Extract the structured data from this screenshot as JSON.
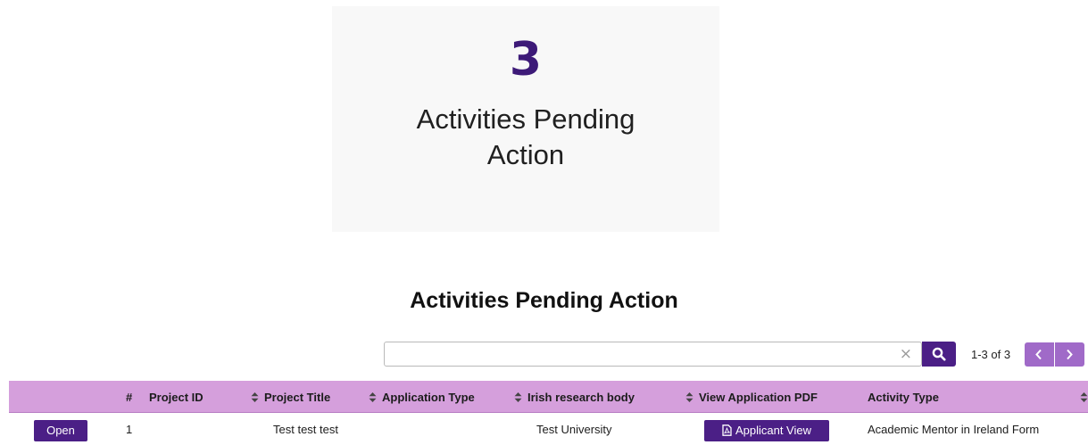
{
  "summary_card": {
    "count": "3",
    "label": "Activities Pending Action"
  },
  "section": {
    "title": "Activities Pending Action"
  },
  "search": {
    "value": "",
    "placeholder": "",
    "clear_symbol": "×"
  },
  "pagination": {
    "range_text": "1-3 of 3"
  },
  "table": {
    "columns": [
      {
        "label": "#",
        "sortable": false
      },
      {
        "label": "Project ID",
        "sortable": false
      },
      {
        "label": "Project Title",
        "sortable": true
      },
      {
        "label": "Application Type",
        "sortable": true
      },
      {
        "label": "Irish research body",
        "sortable": true
      },
      {
        "label": "View Application PDF",
        "sortable": true
      },
      {
        "label": "Activity Type",
        "sortable": false
      }
    ],
    "rows": [
      {
        "action_label": "Open",
        "number": "1",
        "project_id": "",
        "project_title": "Test test test",
        "application_type": "",
        "research_body": "Test University",
        "pdf_button_label": "Applicant View",
        "activity_type": "Academic Mentor in Ireland Form"
      }
    ]
  },
  "colors": {
    "primary": "#4b1f86",
    "header_bg": "#d59fdc",
    "pager_bg": "#a06ac8",
    "count_color": "#3d1a78"
  },
  "icons": {
    "search": "search-icon",
    "clear": "close-icon",
    "prev": "chevron-left-icon",
    "next": "chevron-right-icon",
    "sort": "sort-icon",
    "pdf": "file-pdf-icon"
  }
}
